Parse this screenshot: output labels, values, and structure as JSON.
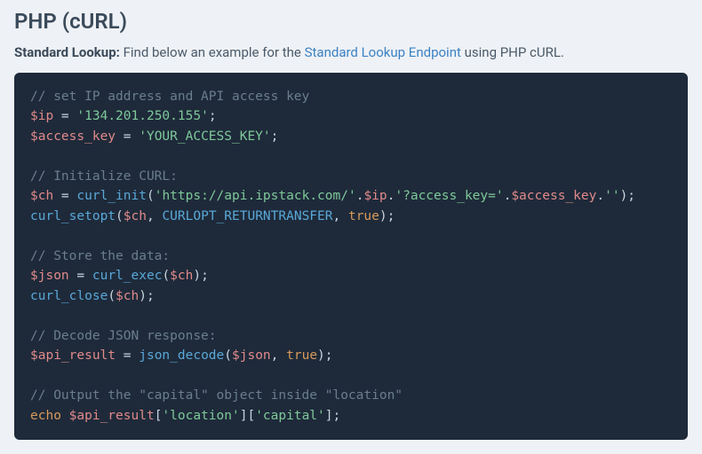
{
  "heading": "PHP (cURL)",
  "intro": {
    "strong": "Standard Lookup:",
    "before_link": " Find below an example for the ",
    "link_text": "Standard Lookup Endpoint",
    "after_link": " using PHP cURL."
  },
  "code": {
    "c1": "// set IP address and API access key",
    "l2_var": "$ip",
    "l2_str": "'134.201.250.155'",
    "l3_var": "$access_key",
    "l3_str": "'YOUR_ACCESS_KEY'",
    "c2": "// Initialize CURL:",
    "l5_var": "$ch",
    "l5_fn": "curl_init",
    "l5_s1": "'https://api.ipstack.com/'",
    "l5_v2": "$ip",
    "l5_s2": "'?access_key='",
    "l5_v3": "$access_key",
    "l5_s3": "''",
    "l6_fn": "curl_setopt",
    "l6_v1": "$ch",
    "l6_cn": "CURLOPT_RETURNTRANSFER",
    "l6_bo": "true",
    "c3": "// Store the data:",
    "l8_var": "$json",
    "l8_fn": "curl_exec",
    "l8_v1": "$ch",
    "l9_fn": "curl_close",
    "l9_v1": "$ch",
    "c4": "// Decode JSON response:",
    "l11_var": "$api_result",
    "l11_fn": "json_decode",
    "l11_v1": "$json",
    "l11_bo": "true",
    "c5": "// Output the \"capital\" object inside \"location\"",
    "l13_kw": "echo",
    "l13_var": "$api_result",
    "l13_s1": "'location'",
    "l13_s2": "'capital'"
  }
}
